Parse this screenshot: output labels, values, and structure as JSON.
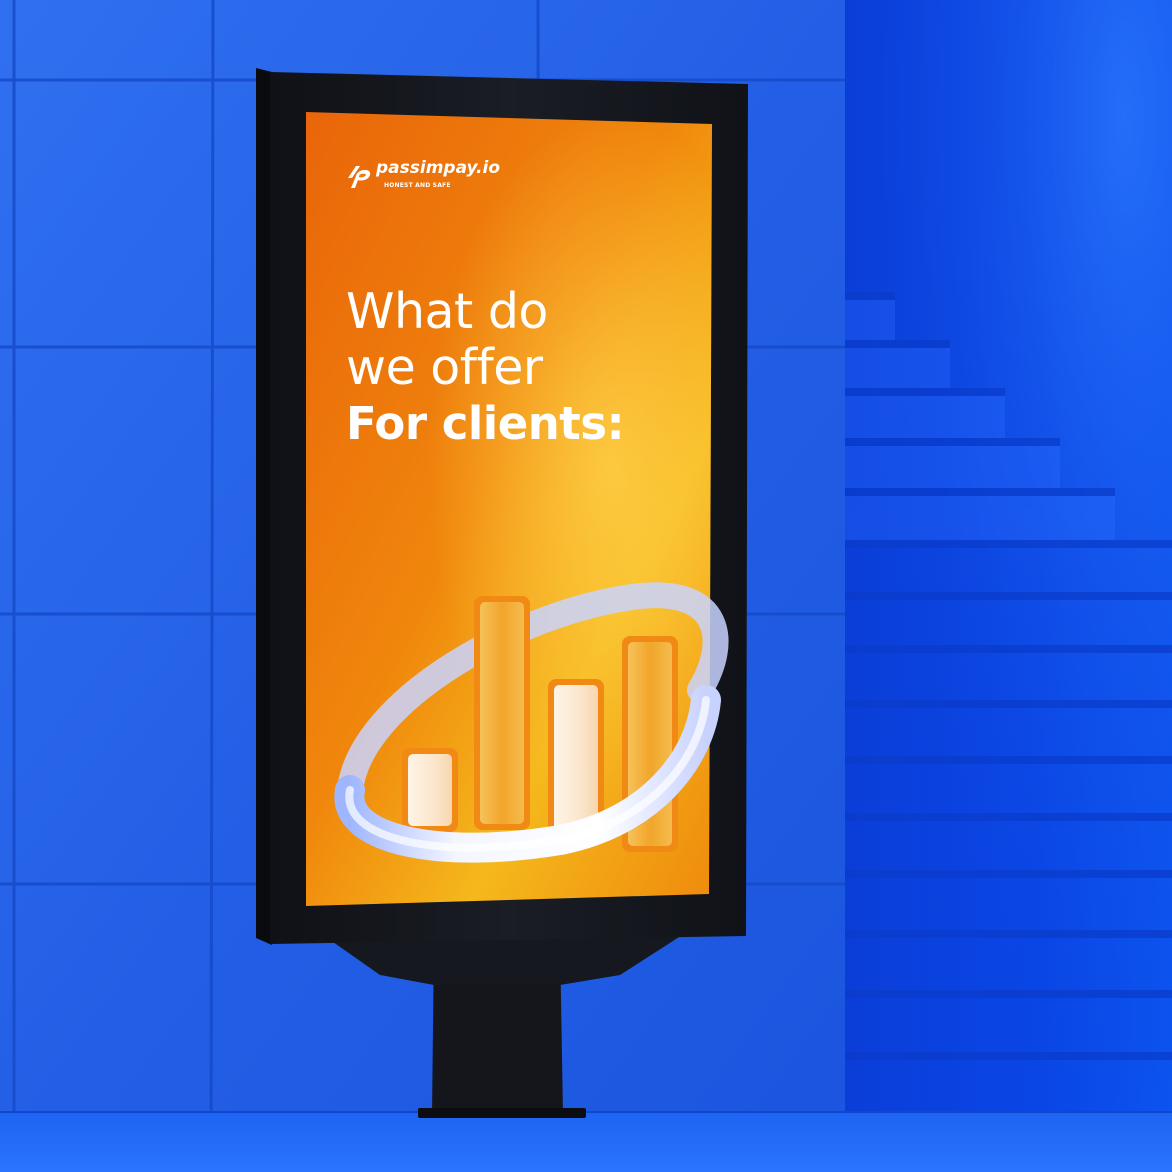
{
  "poster": {
    "brand_name": "passimpay.io",
    "brand_tagline": "HONEST AND SAFE",
    "headline_line1": "What do",
    "headline_line2": "we offer",
    "headline_line3": "For clients:"
  },
  "icons": {
    "brand_logo": "passimpay-logo-icon",
    "illustration": "bar-chart-with-ring-illustration"
  },
  "illustration": {
    "bar_levels": [
      0.28,
      0.78,
      0.53,
      0.72
    ]
  },
  "colors": {
    "wall_blue": "#1a5ae6",
    "stairs_blue": "#0a3fd8",
    "frame_dark": "#14161c",
    "poster_orange": "#ee7a0a",
    "poster_yellow": "#f4b41c",
    "bar_gold": "#f2aa2c",
    "bar_cream": "#fbe8d2",
    "ring_white": "#eef0ff",
    "text_white": "#ffffff"
  }
}
